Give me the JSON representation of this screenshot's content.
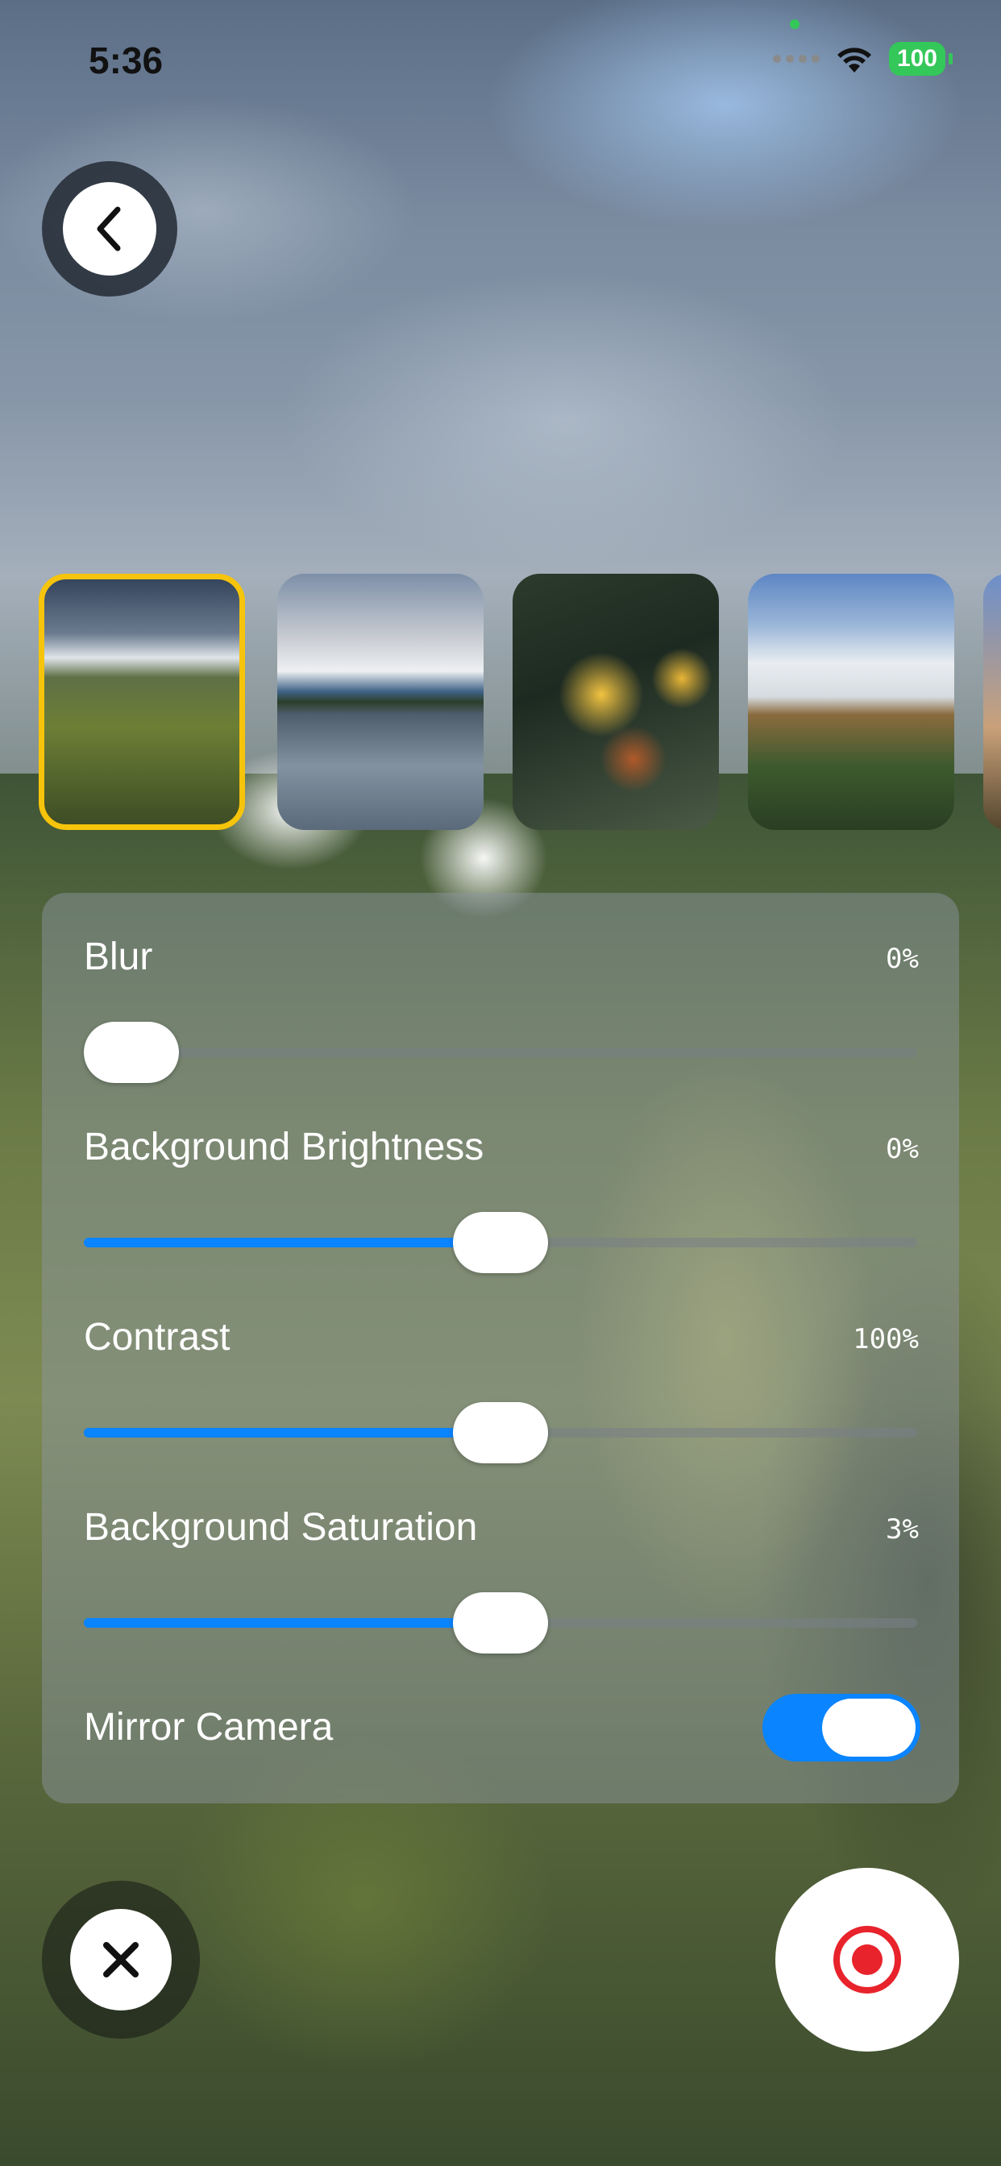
{
  "status_bar": {
    "time": "5:36",
    "battery": "100",
    "icons": [
      "cellular-signal-icon",
      "wifi-icon",
      "battery-icon"
    ]
  },
  "nav": {
    "back_icon": "chevron-left-icon"
  },
  "backgrounds": {
    "selected_index": 0,
    "items": [
      "mountain-ridge",
      "lake-clouds",
      "autumn-leaves",
      "foggy-valley",
      "city-sunset"
    ]
  },
  "settings": {
    "blur": {
      "label": "Blur",
      "value": "0%",
      "level": 0.0
    },
    "brightness": {
      "label": "Background Brightness",
      "value": "0%",
      "level": 0.5
    },
    "contrast": {
      "label": "Contrast",
      "value": "100%",
      "level": 0.5
    },
    "saturation": {
      "label": "Background Saturation",
      "value": "3%",
      "level": 0.5
    },
    "mirror": {
      "label": "Mirror Camera",
      "on": true
    }
  },
  "actions": {
    "close_icon": "close-icon",
    "record_icon": "record-icon"
  },
  "colors": {
    "accent": "#0a84ff",
    "selected_border": "#f6c40b",
    "record": "#e8232b",
    "battery": "#34c759"
  }
}
